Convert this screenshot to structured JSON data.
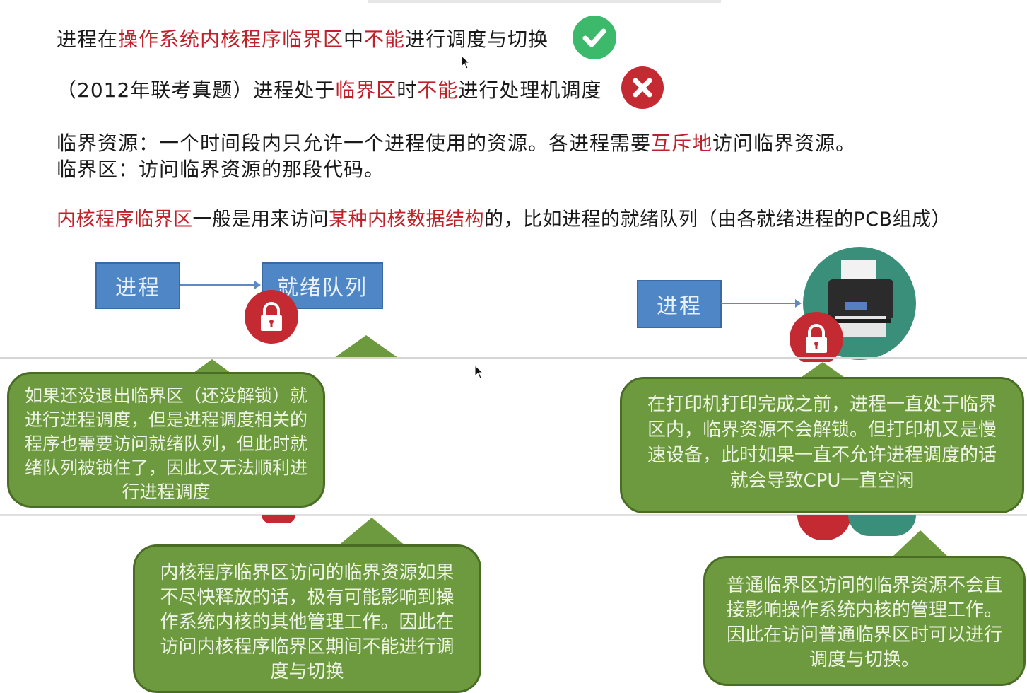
{
  "statements": {
    "s1": {
      "p1": "进程在",
      "r1": "操作系统内核程序临界区",
      "p2": "中",
      "r2": "不能",
      "p3": "进行调度与切换"
    },
    "s2": {
      "p1": "（2012年联考真题）进程处于",
      "r1": "临界区",
      "p2": "时",
      "r2": "不能",
      "p3": "进行处理机调度"
    },
    "s3": {
      "p1": "临界资源：一个时间段内只允许一个进程使用的资源。各进程需要",
      "r1": "互斥地",
      "p2": "访问临界资源。"
    },
    "s4": {
      "p1": "临界区：访问临界资源的那段代码。"
    },
    "s5": {
      "r1": "内核程序临界区",
      "p1": "一般是用来访问",
      "r2": "某种内核数据结构",
      "p2": "的，比如进程的就绪队列（由各就绪进程的PCB组成）"
    }
  },
  "diagram_left": {
    "process_label": "进程",
    "queue_label": "就绪队列"
  },
  "diagram_right": {
    "process_label": "进程"
  },
  "bubbles": {
    "b1": "如果还没退出临界区（还没解锁）就进行进程调度，但是进程调度相关的程序也需要访问就绪队列，但此时就绪队列被锁住了，因此又无法顺利进行进程调度",
    "b2": "在打印机打印完成之前，进程一直处于临界区内，临界资源不会解锁。但打印机又是慢速设备，此时如果一直不允许进程调度的话就会导致CPU一直空闲",
    "b3": "内核程序临界区访问的临界资源如果不尽快释放的话，极有可能影响到操作系统内核的其他管理工作。因此在访问内核程序临界区期间不能进行调度与切换",
    "b4": "普通临界区访问的临界资源不会直接影响操作系统内核的管理工作。因此在访问普通临界区时可以进行调度与切换。"
  },
  "icons": {
    "correct": "check-circle-icon",
    "wrong": "x-circle-icon",
    "lock": "lock-icon",
    "printer": "printer-icon"
  },
  "colors": {
    "highlight": "#c0202a",
    "bubble": "#6e9a3f",
    "box": "#4f86c6",
    "lock": "#c42a31",
    "check": "#3cb96a"
  }
}
